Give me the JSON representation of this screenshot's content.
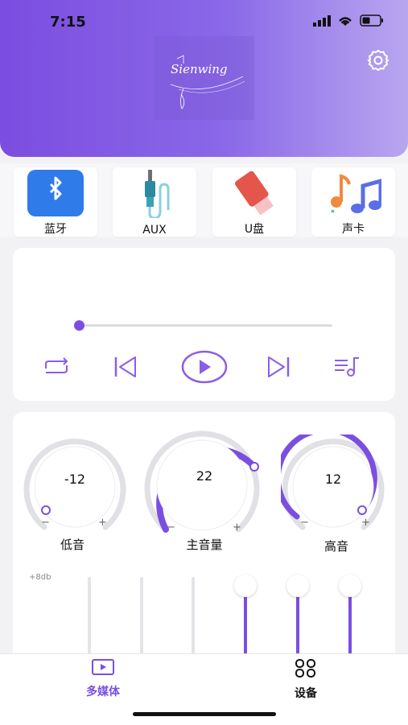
{
  "status_bar": {
    "time": "7:15"
  },
  "header": {
    "logo_text": "Sienwing",
    "settings_icon": "gear-icon",
    "colors": {
      "gradient_start": "#7b4de0",
      "gradient_end": "#b8a6f0"
    }
  },
  "sources": [
    {
      "label": "蓝牙",
      "icon": "bluetooth-icon"
    },
    {
      "label": "AUX",
      "icon": "aux-cable-icon"
    },
    {
      "label": "U盘",
      "icon": "usb-drive-icon"
    },
    {
      "label": "声卡",
      "icon": "music-notes-icon"
    }
  ],
  "player": {
    "progress": 0,
    "controls": [
      "repeat-icon",
      "previous-icon",
      "play-icon",
      "next-icon",
      "playlist-icon"
    ]
  },
  "knobs": [
    {
      "label": "低音",
      "value": "-12",
      "minus": "−",
      "plus": "+"
    },
    {
      "label": "主音量",
      "value": "22",
      "minus": "−",
      "plus": "+"
    },
    {
      "label": "高音",
      "value": "12",
      "minus": "−",
      "plus": "+"
    }
  ],
  "eq": {
    "db_label": "+8db"
  },
  "tabs": [
    {
      "label": "多媒体",
      "icon": "media-play-icon",
      "active": true
    },
    {
      "label": "设备",
      "icon": "grid-icon",
      "active": false
    }
  ],
  "accent_color": "#7a4fe0"
}
